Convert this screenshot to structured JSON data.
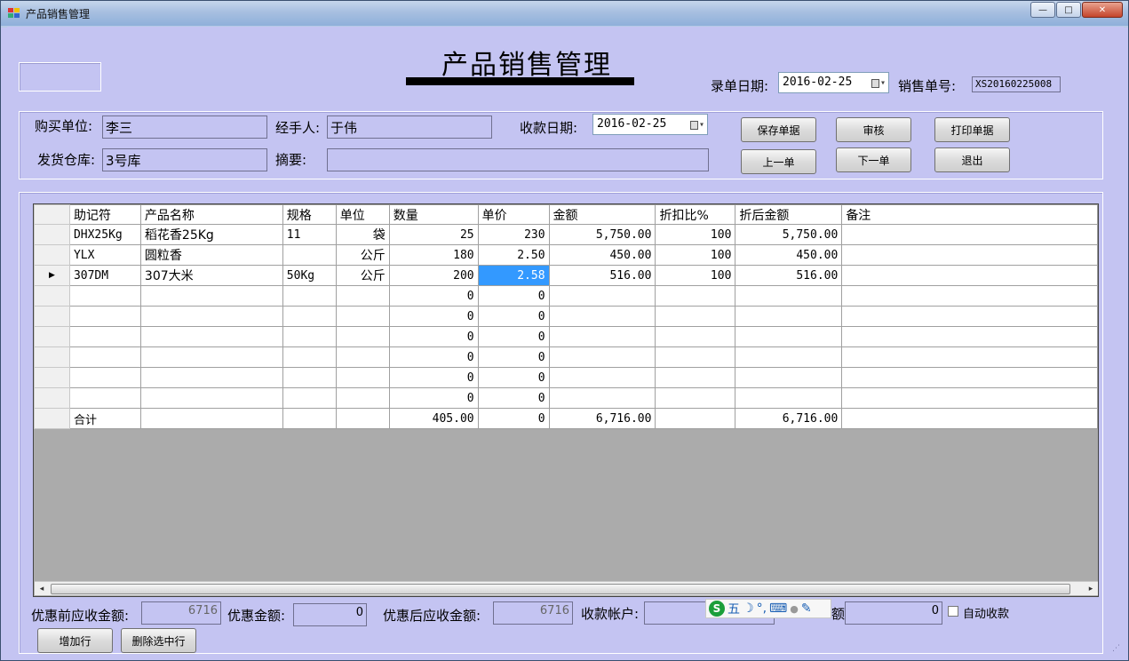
{
  "window": {
    "title": "产品销售管理",
    "minimize": "—",
    "maximize": "□",
    "close": "✕"
  },
  "header": {
    "title": "产品销售管理",
    "entry_date_label": "录单日期:",
    "entry_date": "2016-02-25",
    "sales_no_label": "销售单号:",
    "sales_no": "XS20160225008"
  },
  "form": {
    "buyer_label": "购买单位:",
    "buyer": "李三",
    "handler_label": "经手人:",
    "handler": "于伟",
    "receipt_date_label": "收款日期:",
    "receipt_date": "2016-02-25",
    "warehouse_label": "发货仓库:",
    "warehouse": "3号库",
    "summary_label": "摘要:",
    "summary": ""
  },
  "buttons": {
    "save": "保存单据",
    "review": "审核",
    "print": "打印单据",
    "prev": "上一单",
    "next": "下一单",
    "exit": "退出",
    "add_row": "增加行",
    "delete_row": "删除选中行"
  },
  "grid": {
    "columns": [
      "助记符",
      "产品名称",
      "规格",
      "单位",
      "数量",
      "单价",
      "金额",
      "折扣比%",
      "折后金额",
      "备注"
    ],
    "current_row_marker": "▶",
    "rows": [
      [
        "DHX25Kg",
        "稻花香25Kg",
        "11",
        "袋",
        "25",
        "230",
        "5,750.00",
        "100",
        "5,750.00",
        ""
      ],
      [
        "YLX",
        "圆粒香",
        "",
        "公斤",
        "180",
        "2.50",
        "450.00",
        "100",
        "450.00",
        ""
      ],
      [
        "307DM",
        "307大米",
        "50Kg",
        "公斤",
        "200",
        "2.58",
        "516.00",
        "100",
        "516.00",
        ""
      ],
      [
        "",
        "",
        "",
        "",
        "0",
        "0",
        "",
        "",
        "",
        ""
      ],
      [
        "",
        "",
        "",
        "",
        "0",
        "0",
        "",
        "",
        "",
        ""
      ],
      [
        "",
        "",
        "",
        "",
        "0",
        "0",
        "",
        "",
        "",
        ""
      ],
      [
        "",
        "",
        "",
        "",
        "0",
        "0",
        "",
        "",
        "",
        ""
      ],
      [
        "",
        "",
        "",
        "",
        "0",
        "0",
        "",
        "",
        "",
        ""
      ],
      [
        "",
        "",
        "",
        "",
        "0",
        "0",
        "",
        "",
        "",
        ""
      ]
    ],
    "total": [
      "合计",
      "",
      "",
      "",
      "405.00",
      "0",
      "6,716.00",
      "",
      "6,716.00",
      ""
    ]
  },
  "footer": {
    "pre_discount_label": "优惠前应收金额:",
    "pre_discount": "6716",
    "discount_label": "优惠金额:",
    "discount": "0",
    "post_discount_label": "优惠后应收金额:",
    "post_discount": "6716",
    "account_label": "收款帐户:",
    "account": "",
    "partial_label": "额:",
    "received": "0",
    "auto_receive_label": "自动收款"
  },
  "ime": {
    "logo": "S",
    "mode": "五",
    "moon": "☽",
    "punct": "°,",
    "keyboard": "⌨",
    "user": "●",
    "tools": "✎"
  }
}
